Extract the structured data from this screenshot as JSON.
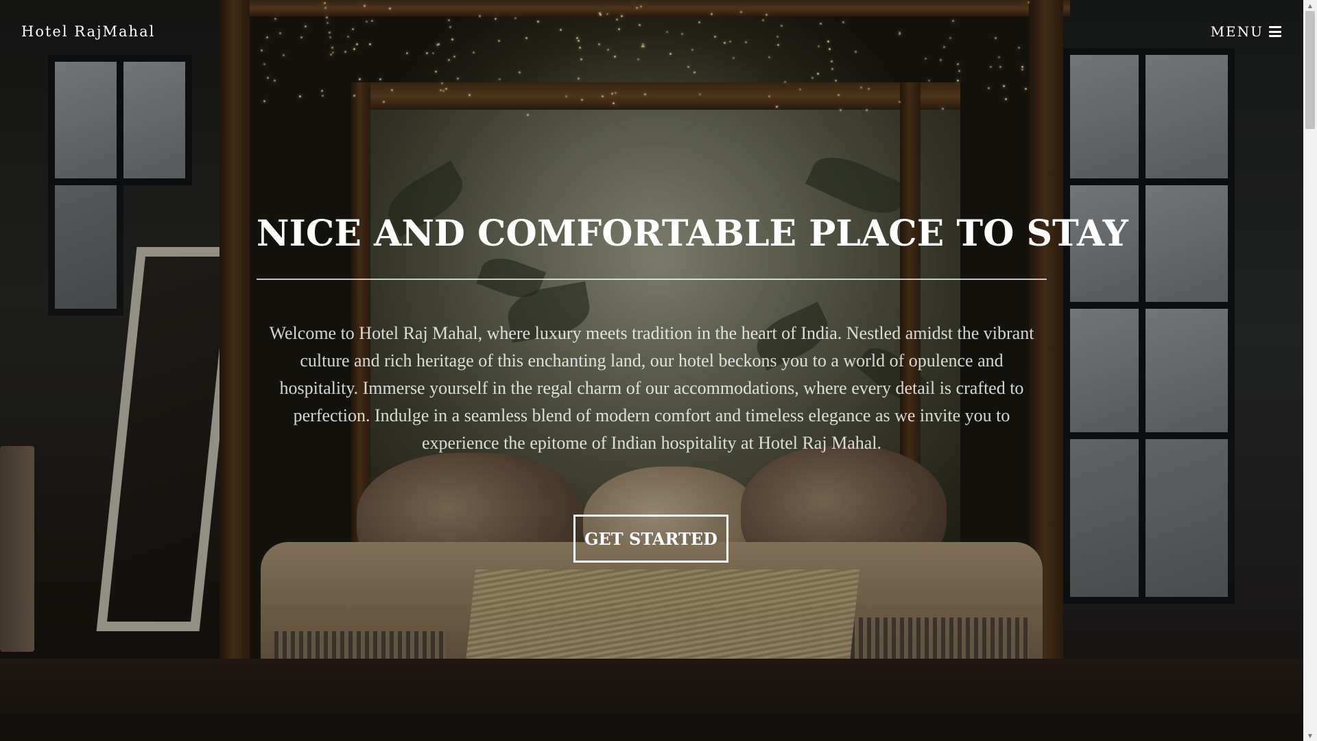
{
  "nav": {
    "brand": "Hotel RajMahal",
    "menu_label": "MENU",
    "menu_icon": "hamburger-icon"
  },
  "hero": {
    "title": "NICE AND COMFORTABLE PLACE TO STAY",
    "description": "Welcome to Hotel Raj Mahal, where luxury meets tradition in the heart of India. Nestled amidst the vibrant culture and rich heritage of this enchanting land, our hotel beckons you to a world of opulence and hospitality. Immerse yourself in the regal charm of our accommodations, where every detail is crafted to perfection. Indulge in a seamless blend of modern comfort and timeless elegance as we invite you to experience the epitome of Indian hospitality at Hotel Raj Mahal.",
    "cta_label": "GET STARTED"
  },
  "colors": {
    "text": "#ffffff",
    "overlay": "rgba(0,0,0,0.28)",
    "wood": "#5a3b1e"
  }
}
